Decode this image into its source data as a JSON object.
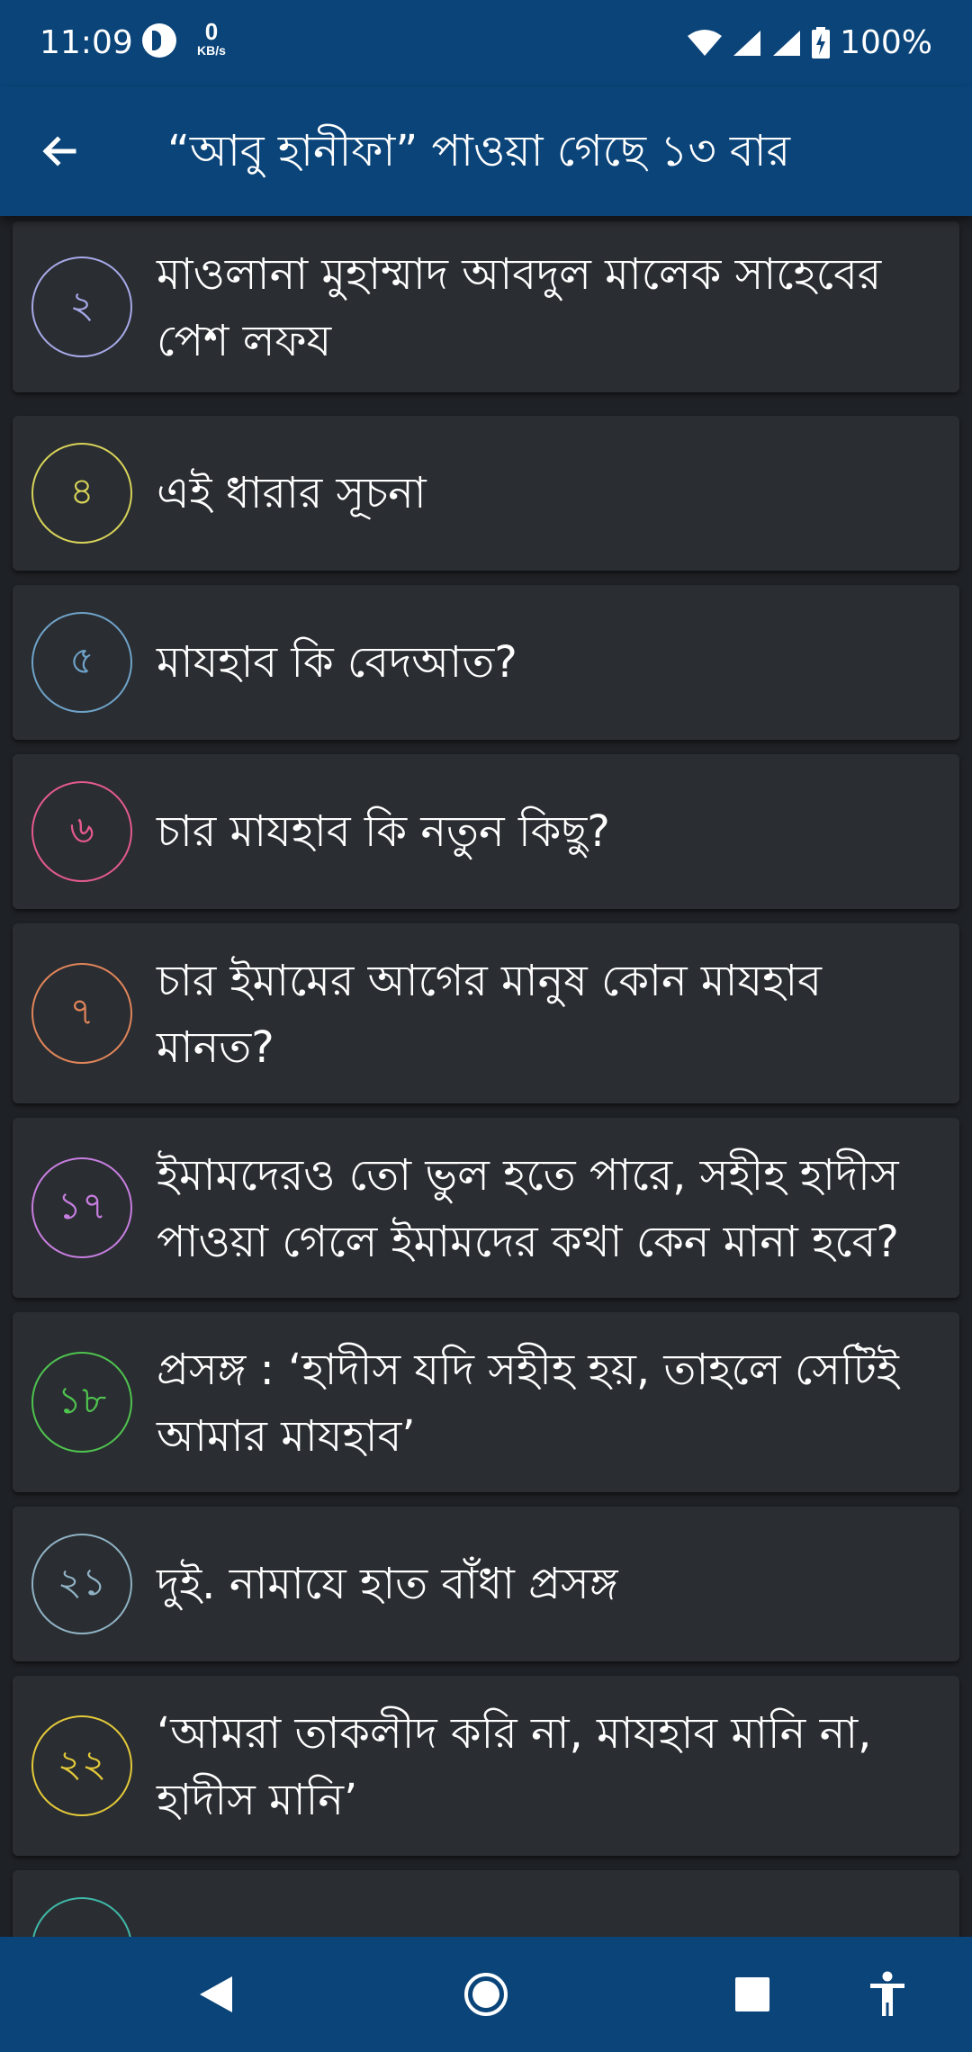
{
  "status_bar": {
    "time": "11:09",
    "net_speed_value": "0",
    "net_speed_unit": "KB/s",
    "battery": "100%"
  },
  "app_bar": {
    "title": "“আবু হানীফা” পাওয়া গেছে ১৩ বার",
    "back_icon": "arrow-left-icon"
  },
  "results": [
    {
      "number": "২",
      "title": "মাওলানা মুহাম্মাদ আবদুল মালেক সাহেবের পেশ লফয",
      "color": "#a7a9e8"
    },
    {
      "number": "৪",
      "title": "এই ধারার সূচনা",
      "color": "#d7d35a"
    },
    {
      "number": "৫",
      "title": "মাযহাব কি বেদআত?",
      "color": "#6fa3c9"
    },
    {
      "number": "৬",
      "title": "চার মাযহাব কি নতুন কিছু?",
      "color": "#e35a8e"
    },
    {
      "number": "৭",
      "title": "চার ইমামের আগের মানুষ কোন মাযহাব মানত?",
      "color": "#e0855a"
    },
    {
      "number": "১৭",
      "title": "ইমামদেরও তো ভুল হতে পারে, সহীহ হাদীস পাওয়া গেলে ইমামদের কথা কেন মানা হবে?",
      "color": "#c77ee0"
    },
    {
      "number": "১৮",
      "title": "প্রসঙ্গ : ‘হাদীস যদি সহীহ হয়, তাহলে সেটিই আমার মাযহাব’",
      "color": "#4fc34f"
    },
    {
      "number": "২১",
      "title": "দুই. নামাযে হাত বাঁধা প্রসঙ্গ",
      "color": "#8fb2c4"
    },
    {
      "number": "২২",
      "title": "‘আমরা তাকলীদ করি না, মাযহাব মানি না, হাদীস মানি’",
      "color": "#e3c93a"
    },
    {
      "number": "",
      "title": "",
      "color": "#3fb8a8"
    }
  ],
  "nav_bar": {
    "back_icon": "triangle-back-icon",
    "home_icon": "circle-home-icon",
    "recents_icon": "square-recents-icon",
    "accessibility_icon": "accessibility-icon"
  },
  "colors": {
    "primary": "#0a4479",
    "background": "#1e2126",
    "card": "#2a2d31"
  }
}
